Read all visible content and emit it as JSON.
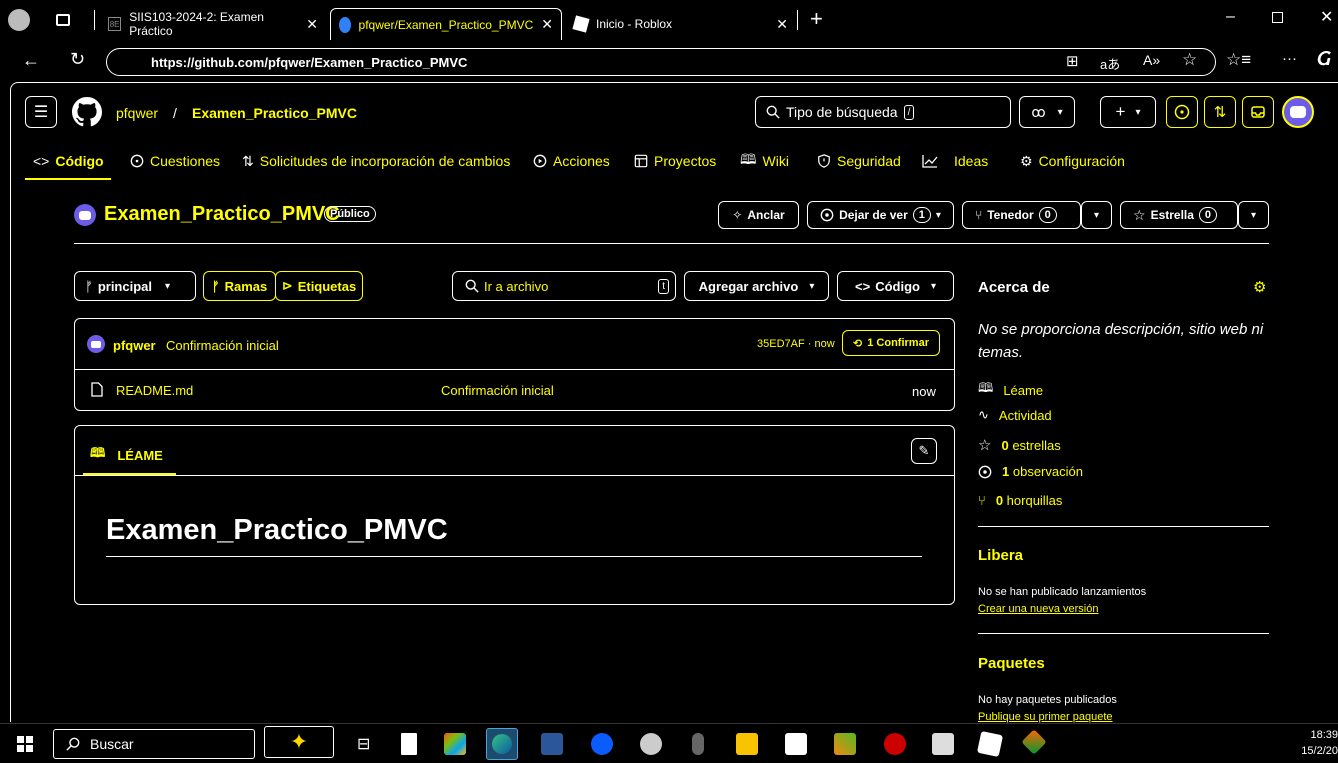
{
  "browser": {
    "tabs": [
      {
        "label": "SIIS103-2024-2: Examen Práctico"
      },
      {
        "label": "pfqwer/Examen_Practico_PMVC"
      },
      {
        "label": "Inicio - Roblox"
      }
    ],
    "url": "https://github.com/pfqwer/Examen_Practico_PMVC",
    "toolbar_extra": "aあ"
  },
  "header": {
    "owner": "pfqwer",
    "separator": "/",
    "repo": "Examen_Practico_PMVC",
    "search_placeholder": "Tipo de búsqueda",
    "search_key": "/",
    "create_label": "+"
  },
  "nav": {
    "items": [
      {
        "label": "Código"
      },
      {
        "label": "Cuestiones"
      },
      {
        "label": "Solicitudes de incorporación de cambios"
      },
      {
        "label": "Acciones"
      },
      {
        "label": "Proyectos"
      },
      {
        "label": "Wiki"
      },
      {
        "label": "Seguridad"
      },
      {
        "label": "Ideas"
      },
      {
        "label": "Configuración"
      }
    ]
  },
  "repo_header": {
    "name": "Examen_Practico_PMVC",
    "visibility": "Público",
    "pin_label": "Anclar",
    "watch_label": "Dejar de ver",
    "watch_count": "1",
    "fork_label": "Tenedor",
    "fork_count": "0",
    "star_label": "Estrella",
    "star_count": "0"
  },
  "file_nav": {
    "branch": "principal",
    "branches_label": "Ramas",
    "tags_label": "Etiquetas",
    "goto_placeholder": "Ir a archivo",
    "goto_key": "t",
    "add_file_label": "Agregar archivo",
    "code_label": "Código"
  },
  "commit": {
    "author": "pfqwer",
    "message": "Confirmación inicial",
    "hash_time": "35ED7AF · now",
    "commits_label": "1 Confirmar"
  },
  "files": [
    {
      "name": "README.md",
      "message": "Confirmación inicial",
      "time": "now"
    }
  ],
  "readme": {
    "tab_label": "LÉAME",
    "heading": "Examen_Practico_PMVC"
  },
  "about": {
    "title": "Acerca de",
    "description": "No se proporciona descripción, sitio web ni temas.",
    "links": [
      {
        "label": "Léame"
      },
      {
        "label": "Actividad"
      },
      {
        "count": "0",
        "label": "estrellas"
      },
      {
        "count": "1",
        "label": "observación"
      },
      {
        "count": "0",
        "label": "horquillas"
      }
    ],
    "releases_title": "Libera",
    "releases_text": "No se han publicado lanzamientos",
    "releases_link": "Crear una nueva versión",
    "packages_title": "Paquetes",
    "packages_text": "No hay paquetes publicados",
    "packages_link": "Publique su primer paquete"
  },
  "taskbar": {
    "search_label": "Buscar",
    "time": "18:39",
    "date": "15/2/20"
  },
  "colors": {
    "accent": "#ffff00",
    "background": "#000000",
    "border": "#ffffff"
  }
}
